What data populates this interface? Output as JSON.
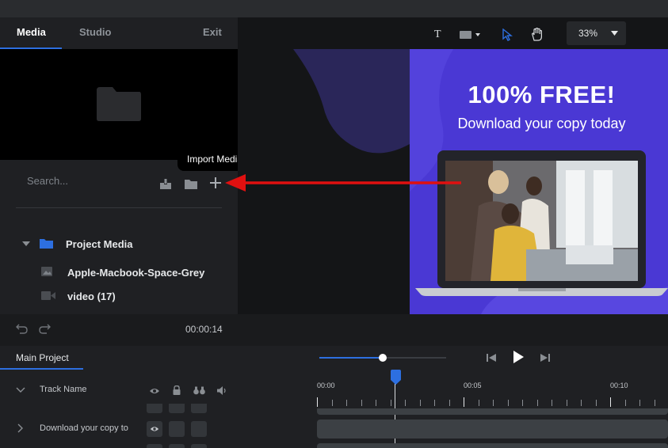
{
  "tabs": {
    "media": "Media",
    "studio": "Studio",
    "exit": "Exit"
  },
  "search": {
    "placeholder": "Search..."
  },
  "tooltip": "Import Media",
  "tree": {
    "root": "Project Media",
    "items": [
      {
        "label": "Apple-Macbook-Space-Grey",
        "icon": "image-icon"
      },
      {
        "label": "video (17)",
        "icon": "video-icon"
      }
    ]
  },
  "toolbar": {
    "text_tool": "T",
    "zoom": "33%"
  },
  "ad": {
    "title": "100% FREE!",
    "subtitle": "Download your copy today"
  },
  "time": "00:00:14",
  "timeline": {
    "tab": "Main Project",
    "track_header": "Track Name",
    "ruler": [
      "00:00",
      "00:05",
      "00:10"
    ],
    "tracks": [
      {
        "label": "Download your copy to"
      }
    ],
    "scrub_progress": 0.5
  },
  "colors": {
    "accent": "#2d6fe0",
    "arrow": "#e01010",
    "ad_bg": "#4a38d4"
  }
}
